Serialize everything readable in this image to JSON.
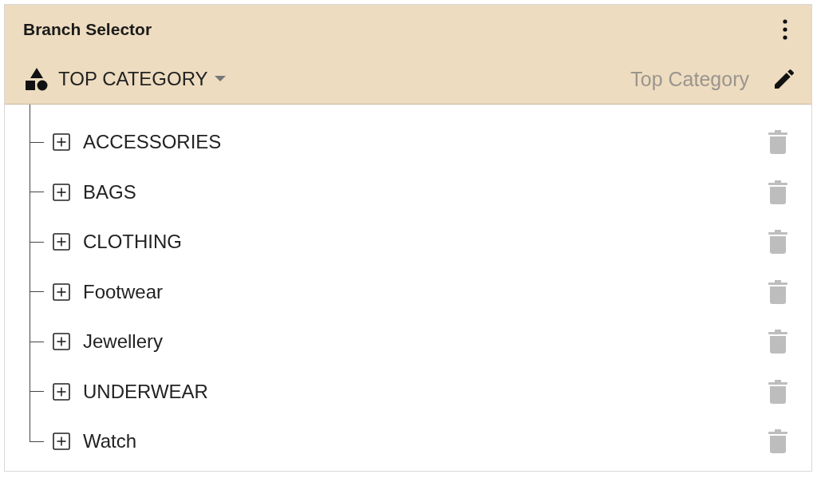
{
  "panel": {
    "title": "Branch Selector"
  },
  "category": {
    "label": "TOP CATEGORY",
    "name_field": {
      "placeholder": "Top Category"
    }
  },
  "tree": {
    "items": [
      {
        "label": "ACCESSORIES",
        "expanded": false
      },
      {
        "label": "BAGS",
        "expanded": false
      },
      {
        "label": "CLOTHING",
        "expanded": false
      },
      {
        "label": "Footwear",
        "expanded": false
      },
      {
        "label": "Jewellery",
        "expanded": false
      },
      {
        "label": "UNDERWEAR",
        "expanded": false
      },
      {
        "label": "Watch",
        "expanded": false
      }
    ]
  }
}
